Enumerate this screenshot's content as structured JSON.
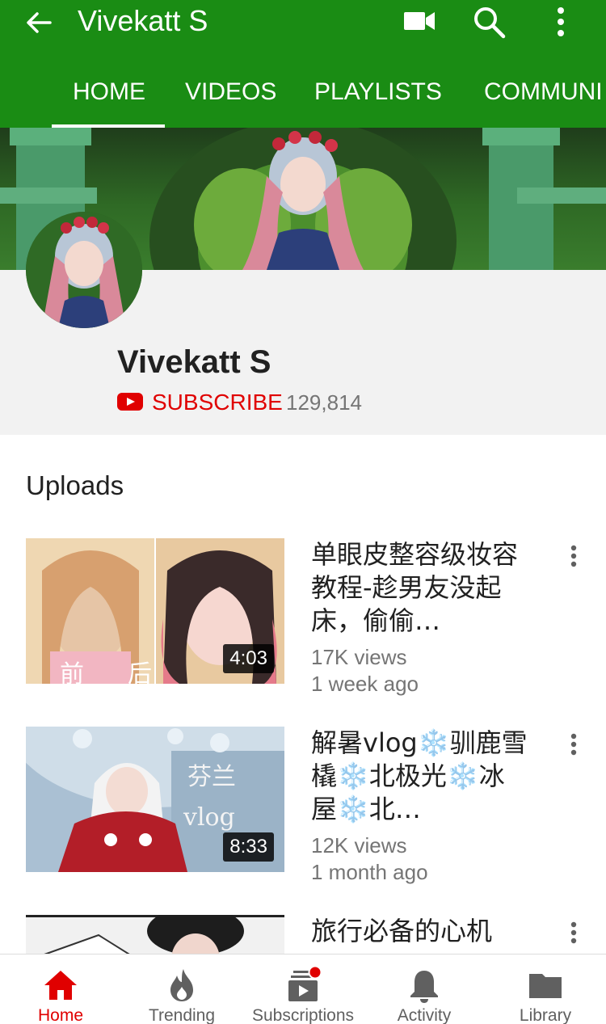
{
  "appbar": {
    "title": "Vivekatt S",
    "icons": [
      "back-arrow-icon",
      "video-camera-icon",
      "search-icon",
      "more-vert-icon"
    ],
    "color": "#1a8c14"
  },
  "tabs": [
    {
      "label": "HOME",
      "active": true
    },
    {
      "label": "VIDEOS",
      "active": false
    },
    {
      "label": "PLAYLISTS",
      "active": false
    },
    {
      "label": "COMMUNI",
      "active": false
    }
  ],
  "channel": {
    "name": "Vivekatt S",
    "subscribe_label": "SUBSCRIBE",
    "subscriber_count": "129,814"
  },
  "uploads": {
    "title": "Uploads",
    "videos": [
      {
        "title": "单眼皮整容级妆容教程-趁男友没起床，偷偷…",
        "duration": "4:03",
        "views": "17K views",
        "age": "1 week ago",
        "thumb_text": [
          "前",
          "后"
        ]
      },
      {
        "title": "解暑vlog❄️驯鹿雪橇❄️北极光❄️冰屋❄️北…",
        "duration": "8:33",
        "views": "12K views",
        "age": "1 month ago",
        "thumb_text": [
          "芬兰",
          "vlog"
        ]
      },
      {
        "title": "旅行必备的心机",
        "duration": "",
        "views": "",
        "age": ""
      }
    ]
  },
  "bottom_nav": [
    {
      "label": "Home",
      "icon": "home-icon",
      "active": true
    },
    {
      "label": "Trending",
      "icon": "flame-icon",
      "active": false
    },
    {
      "label": "Subscriptions",
      "icon": "subscriptions-icon",
      "active": false
    },
    {
      "label": "Activity",
      "icon": "bell-icon",
      "active": false
    },
    {
      "label": "Library",
      "icon": "folder-icon",
      "active": false
    }
  ],
  "colors": {
    "accent_red": "#e00000",
    "brand_green": "#1a8c14",
    "nav_inactive": "#606060"
  }
}
